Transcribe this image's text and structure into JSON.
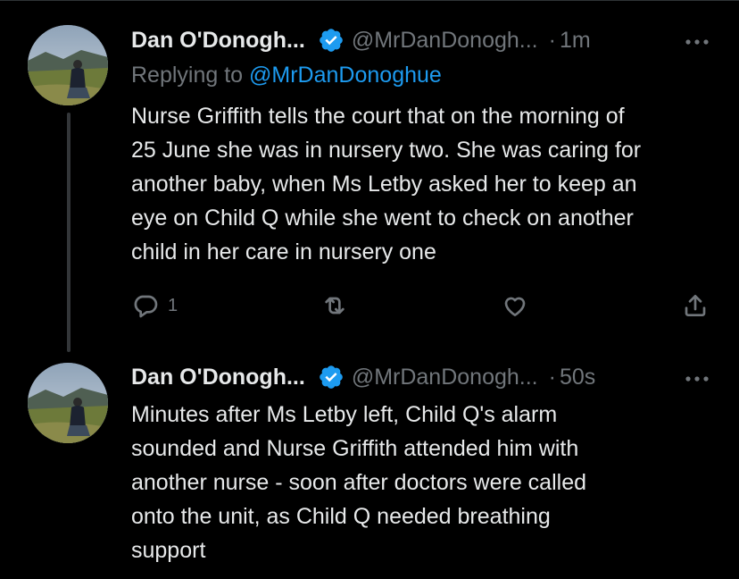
{
  "tweets": [
    {
      "author_name": "Dan O'Donogh...",
      "handle": "@MrDanDonogh...",
      "separator": "·",
      "time": "1m",
      "reply_prefix": "Replying to",
      "reply_mention": "@MrDanDonoghue",
      "text": "Nurse Griffith tells the court that on the morning of\n25 June she was in nursery two. She was caring for\nanother baby, when Ms Letby asked her to keep an\neye on Child Q while she went to check on another\nchild in her care in nursery one",
      "reply_count": "1",
      "avatar_icon": "avatar-photo",
      "verified_icon": "verified-badge-icon"
    },
    {
      "author_name": "Dan O'Donogh...",
      "handle": "@MrDanDonogh...",
      "separator": "·",
      "time": "50s",
      "text": "Minutes after Ms Letby left, Child Q's alarm\nsounded and Nurse Griffith attended him with\nanother nurse - soon after doctors were called\nonto the unit, as Child Q needed breathing\nsupport",
      "avatar_icon": "avatar-photo",
      "verified_icon": "verified-badge-icon"
    }
  ],
  "colors": {
    "background": "#000000",
    "text": "#e7e9ea",
    "secondary": "#71767b",
    "accent": "#1d9bf0"
  },
  "icons": [
    "reply-icon",
    "retweet-icon",
    "like-icon",
    "share-icon",
    "more-icon"
  ]
}
